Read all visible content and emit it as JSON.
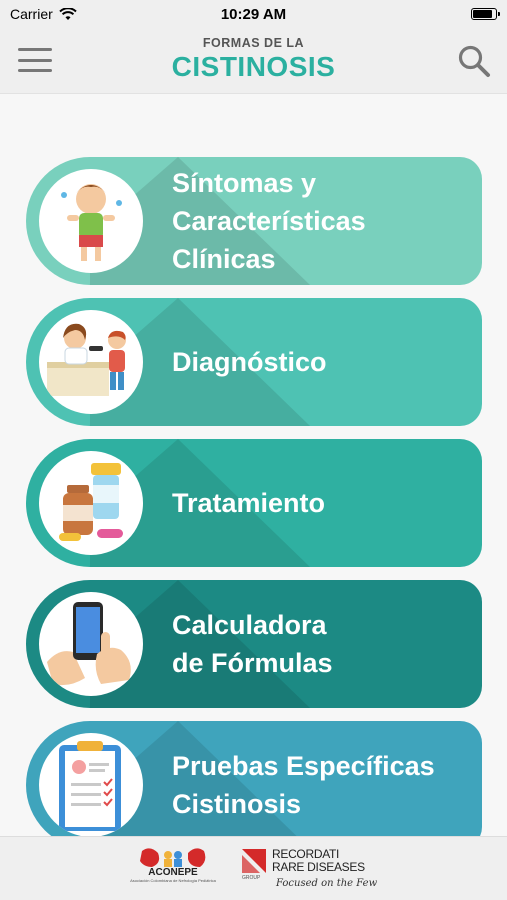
{
  "status": {
    "carrier": "Carrier",
    "time": "10:29 AM"
  },
  "header": {
    "subtitle": "FORMAS DE LA",
    "title": "CISTINOSIS"
  },
  "menu": [
    {
      "label": "Síntomas y\nCaracterísticas\nClínicas",
      "color": "#79d0bd",
      "icon": "child-symptoms-icon"
    },
    {
      "label": "Diagnóstico",
      "color": "#4ec2b3",
      "icon": "doctor-exam-icon"
    },
    {
      "label": "Tratamiento",
      "color": "#2fb0a1",
      "icon": "medicine-bottles-icon"
    },
    {
      "label": "Calculadora\nde Fórmulas",
      "color": "#1c8a84",
      "icon": "phone-hand-icon"
    },
    {
      "label": "Pruebas Específicas\nCistinosis",
      "color": "#3fa4bc",
      "icon": "clipboard-icon"
    }
  ],
  "footer": {
    "aconepe_name": "ACONEPE",
    "aconepe_tagline": "Asociación Colombiana de Nefrología Pediátrica",
    "recordati_line1": "RECORDATI",
    "recordati_line2": "RARE DISEASES",
    "recordati_group": "GROUP",
    "recordati_tagline": "Focused on the Few"
  }
}
